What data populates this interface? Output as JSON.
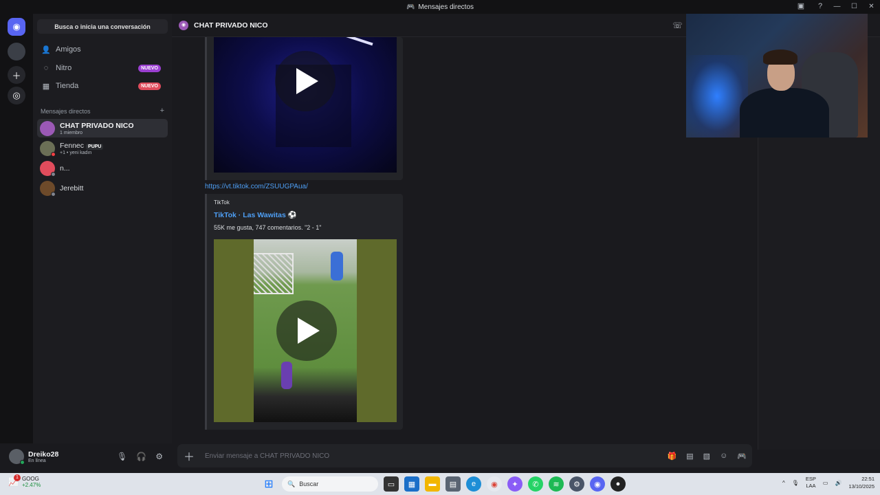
{
  "window": {
    "title": "Mensajes directos"
  },
  "search": {
    "placeholder": "Busca o inicia una conversación"
  },
  "nav": {
    "friends": "Amigos",
    "nitro": "Nitro",
    "nitro_badge": "NUEVO",
    "shop": "Tienda",
    "shop_badge": "NUEVO"
  },
  "dm_section": {
    "title": "Mensajes directos",
    "add": "+"
  },
  "dms": [
    {
      "name": "CHAT PRIVADO NICO",
      "sub": "1 miembro"
    },
    {
      "name": "Fennec",
      "tag": "PUPU",
      "sub": "+1 • yeni kadın"
    },
    {
      "name": "n...",
      "sub": ""
    },
    {
      "name": "Jerebitt",
      "sub": ""
    }
  ],
  "user": {
    "name": "Dreiko28",
    "status": "En línea"
  },
  "channel": {
    "title": "CHAT PRIVADO NICO"
  },
  "messages": {
    "link": "https://vt.tiktok.com/ZSUUGPAua/",
    "embed_provider": "TikTok",
    "embed_title": "TikTok · Las Wawitas ⚽",
    "embed_desc": "55K me gusta, 747 comentarios. \"2 - 1\""
  },
  "composer": {
    "placeholder": "Enviar mensaje a CHAT PRIVADO NICO"
  },
  "taskbar": {
    "stock_name": "GOOG",
    "stock_change": "+2.47%",
    "stock_badge": "1",
    "search_label": "Buscar",
    "lang_1": "ESP",
    "lang_2": "LAA",
    "time": "22:51",
    "date": "13/10/2025"
  },
  "colors": {
    "discord_blurple": "#5865f2",
    "badge_red": "#e04c5c",
    "link_blue": "#4e9ff5",
    "online_green": "#23a55a"
  }
}
